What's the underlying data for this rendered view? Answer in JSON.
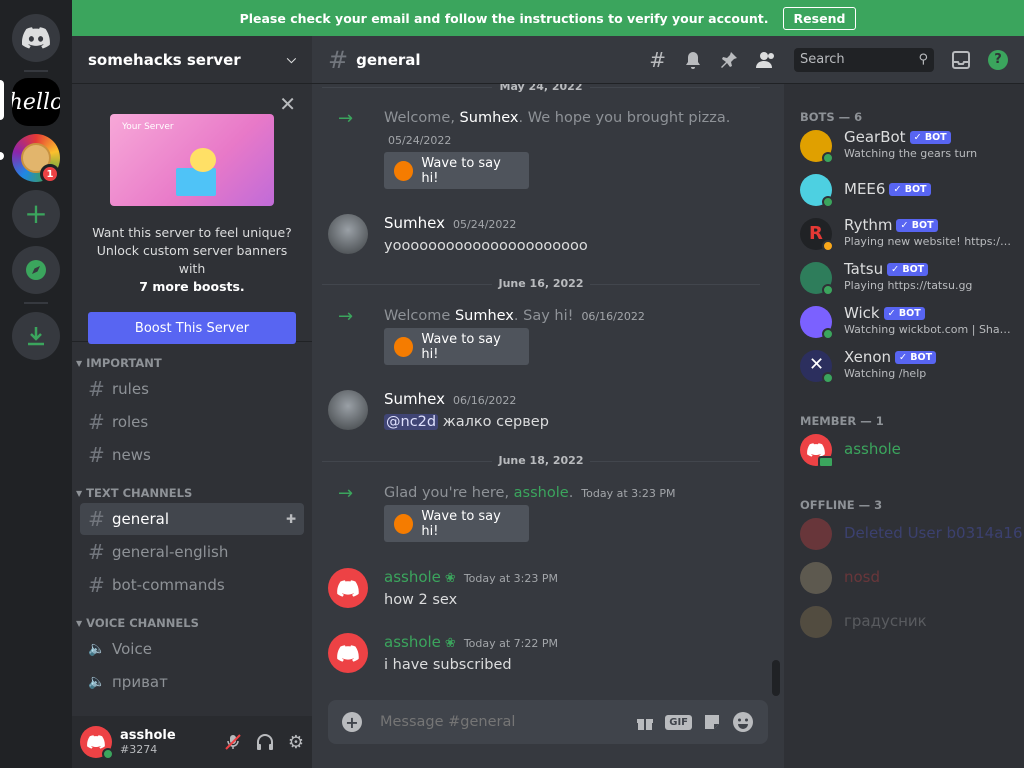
{
  "banner": {
    "text": "Please check your email and follow the instructions to verify your account.",
    "button": "Resend"
  },
  "server": {
    "name": "somehacks server"
  },
  "guilds": {
    "hello_label": "hello",
    "badge": "1"
  },
  "boost": {
    "art_label": "Your Server",
    "line1": "Want this server to feel unique?",
    "line2": "Unlock custom server banners with",
    "line3": "7 more boosts.",
    "button": "Boost This Server"
  },
  "categories": [
    {
      "name": "IMPORTANT",
      "channels": [
        "rules",
        "roles",
        "news"
      ]
    },
    {
      "name": "TEXT CHANNELS",
      "channels": [
        "general",
        "general-english",
        "bot-commands"
      ]
    },
    {
      "name": "VOICE CHANNELS",
      "channels": [
        "Voice",
        "приват"
      ]
    }
  ],
  "userbar": {
    "name": "asshole",
    "tag": "#3274"
  },
  "header": {
    "channel": "general",
    "search_placeholder": "Search"
  },
  "messages": {
    "d1": "May 24, 2022",
    "s1": {
      "pre": "Welcome, ",
      "user": "Sumhex",
      "post": ". We hope you brought pizza.",
      "ts": "05/24/2022"
    },
    "wave": "Wave to say hi!",
    "m1": {
      "user": "Sumhex",
      "ts": "05/24/2022",
      "text": "yoooooooooooooooooooooo"
    },
    "d2": "June 16, 2022",
    "s2": {
      "pre": "Welcome ",
      "user": "Sumhex",
      "post": ". Say hi!",
      "ts": "06/16/2022"
    },
    "m2": {
      "user": "Sumhex",
      "ts": "06/16/2022",
      "mention": "@nc2d",
      "text": " жалко сервер"
    },
    "d3": "June 18, 2022",
    "s3": {
      "pre": "Glad you're here, ",
      "user": "asshole",
      "post": ".",
      "ts": "Today at 3:23 PM"
    },
    "m3": {
      "user": "asshole",
      "ts": "Today at 3:23 PM",
      "text": "how 2 sex"
    },
    "m4": {
      "user": "asshole",
      "ts": "Today at 7:22 PM",
      "text": "i have subscribed"
    }
  },
  "composer": {
    "placeholder": "Message #general",
    "gif": "GIF"
  },
  "members": {
    "bots_header": "BOTS — 6",
    "bot_badge": "✓ BOT",
    "bots": [
      {
        "name": "GearBot",
        "activity": "Watching the gears turn",
        "color": "#e0a000"
      },
      {
        "name": "MEE6",
        "activity": "",
        "color": "#4dd0e1"
      },
      {
        "name": "Rythm",
        "activity": "Playing new website! https://r...",
        "color": "#202225"
      },
      {
        "name": "Tatsu",
        "activity": "Playing https://tatsu.gg",
        "color": "#2e7d5b"
      },
      {
        "name": "Wick",
        "activity": "Watching wickbot.com | Shard...",
        "color": "#7b61ff"
      },
      {
        "name": "Xenon",
        "activity": "Watching /help",
        "color": "#2c2f5e"
      }
    ],
    "member_header": "MEMBER — 1",
    "member": {
      "name": "asshole"
    },
    "offline_header": "OFFLINE — 3",
    "offline": [
      "Deleted User b0314a16",
      "nosd",
      "градусник"
    ]
  }
}
